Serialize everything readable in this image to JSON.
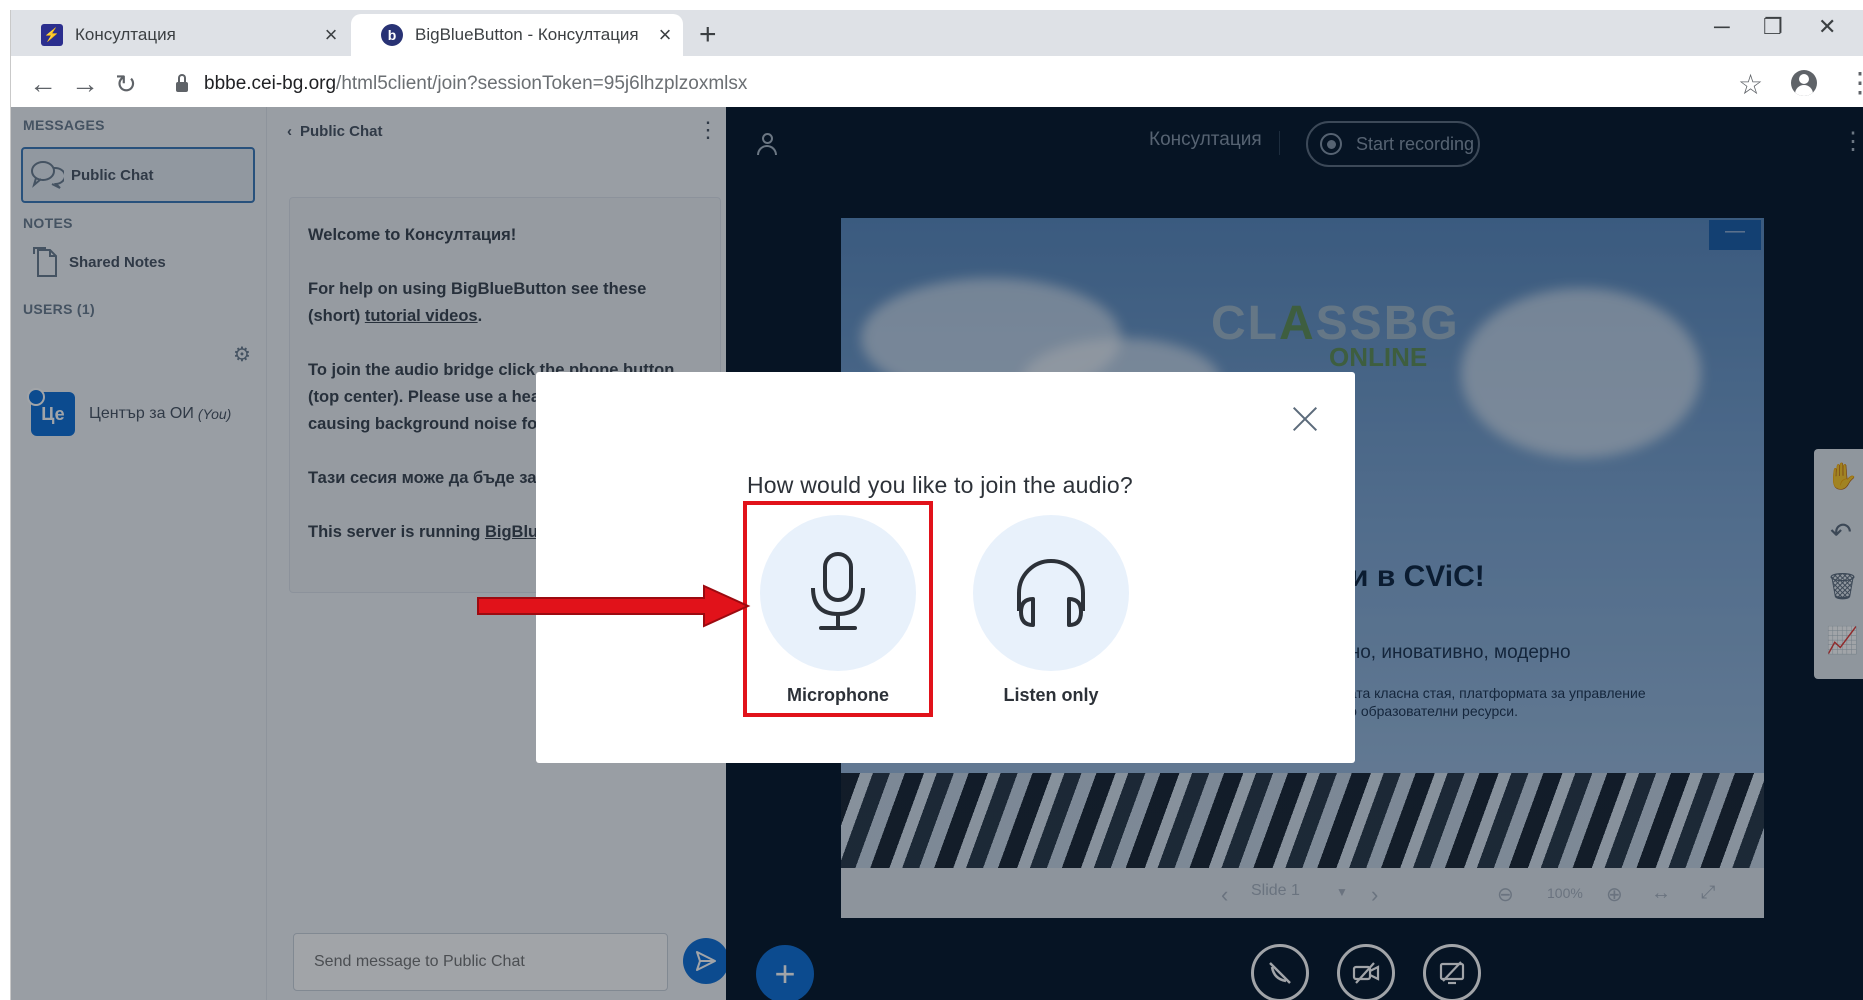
{
  "browser": {
    "tabs": [
      {
        "title": "Консултация",
        "active": false
      },
      {
        "title": "BigBlueButton - Консултация",
        "active": true
      }
    ],
    "tab_close_glyph": "×",
    "new_tab_glyph": "+",
    "url_host": "bbbe.cei-bg.org",
    "url_path": "/html5client/join?sessionToken=95j6lhzplzoxmlsx",
    "window_controls": [
      "─",
      "❐",
      "✕"
    ],
    "icons": [
      "back-icon",
      "forward-icon",
      "reload-icon",
      "lock-icon",
      "star-icon",
      "account-icon",
      "menu-icon"
    ]
  },
  "sidebar": {
    "messages_title": "MESSAGES",
    "public_chat_label": "Public Chat",
    "notes_title": "NOTES",
    "shared_notes_label": "Shared Notes",
    "users_title": "USERS (1)",
    "user": {
      "avatar": "Це",
      "name": "Център за ОИ",
      "you": "(You)"
    }
  },
  "chat": {
    "header": "Public Chat",
    "welcome_prefix": "Welcome to ",
    "welcome_name": "Консултация",
    "welcome_suffix": "!",
    "help_prefix": "For help on using BigBlueButton see these (short) ",
    "help_link": "tutorial videos",
    "help_suffix": ".",
    "audio_text": "To join the audio bridge click the phone button (top center). Please use a headset to avoid causing background noise for others.",
    "recording_text": "Тази сесия може да бъде записана.",
    "server_prefix": "This server is running ",
    "server_link": "BigBlueButton",
    "input_placeholder": "Send message to Public Chat"
  },
  "presentation": {
    "meeting_title": "Консултация",
    "start_recording": "Start recording",
    "slide_logo_a": "CL",
    "slide_logo_b": "A",
    "slide_logo_c": "SS",
    "slide_logo_d": "BG",
    "slide_logo_sub": "ONLINE",
    "slide_heading": "ли в CViC!",
    "slide_line": "зно, иновативно, модерно",
    "slide_small_1": "ната класна стая, платформата за управление",
    "slide_small_2": "до образователни ресурси.",
    "slide_label": "Slide 1",
    "zoom": "100%"
  },
  "modal": {
    "title": "How would you like to join the audio?",
    "microphone_label": "Microphone",
    "listen_only_label": "Listen only"
  },
  "colors": {
    "accent": "#0f70d7",
    "highlight": "#e1121a",
    "presentation_bg": "#06172a"
  }
}
